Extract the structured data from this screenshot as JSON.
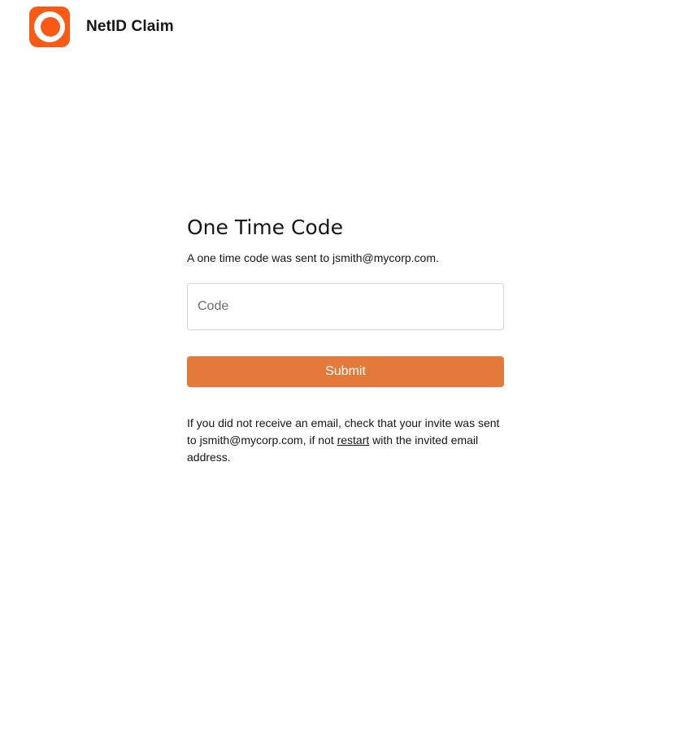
{
  "header": {
    "logo_icon": "brand-logo-icon",
    "brand_color": "#fa5a14",
    "title": "NetID Claim"
  },
  "main": {
    "title": "One Time Code",
    "subtitle": "A one time code was sent to jsmith@mycorp.com.",
    "code_input": {
      "placeholder": "Code",
      "value": ""
    },
    "submit_label": "Submit",
    "submit_color": "#e47a3a",
    "help": {
      "before": "If you did not receive an email, check that your invite was sent to jsmith@mycorp.com, if not ",
      "link": "restart",
      "after": " with the invited email address."
    }
  }
}
